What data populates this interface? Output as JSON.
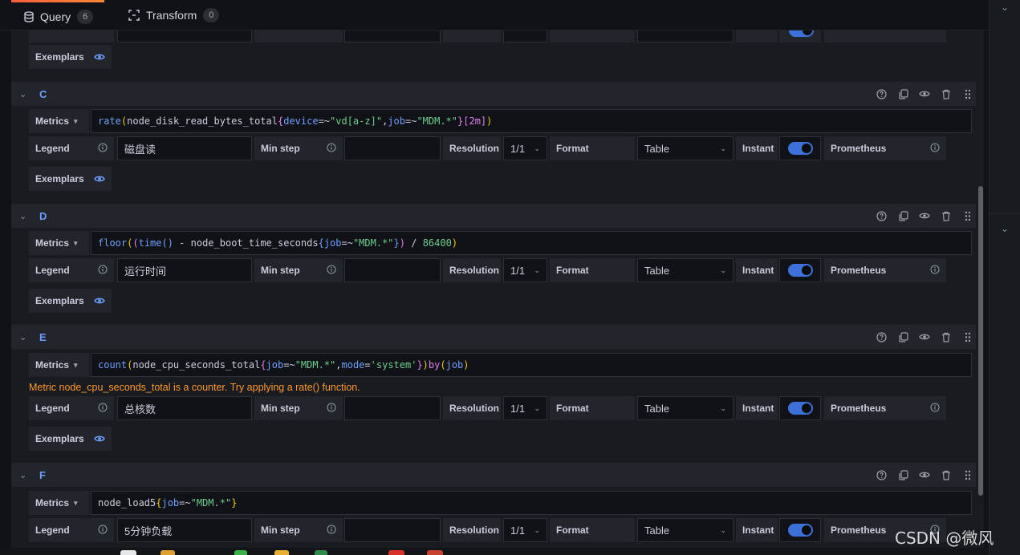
{
  "tabs": [
    {
      "label": "Query",
      "count": "6"
    },
    {
      "label": "Transform",
      "count": "0"
    }
  ],
  "labels": {
    "exemplars": "Exemplars",
    "metrics": "Metrics",
    "legend": "Legend",
    "min_step": "Min step",
    "resolution": "Resolution",
    "format": "Format",
    "instant": "Instant",
    "datasource": "Prometheus"
  },
  "queries": [
    {
      "letter": "C",
      "legend": "磁盘读",
      "resolution": "1/1",
      "format": "Table"
    },
    {
      "letter": "D",
      "legend": "运行时间",
      "resolution": "1/1",
      "format": "Table"
    },
    {
      "letter": "E",
      "legend": "总核数",
      "resolution": "1/1",
      "format": "Table",
      "warning": "Metric node_cpu_seconds_total is a counter. Try applying a rate() function."
    },
    {
      "letter": "F",
      "legend": "5分钟负载",
      "resolution": "1/1",
      "format": "Table"
    }
  ],
  "partial_top": {
    "legend": "..."
  },
  "watermark": "CSDN @微风",
  "colors": {
    "accent": "#6e9fff",
    "warning": "#ff9830",
    "toggle": "#3d71d9",
    "string": "#6ccf8e",
    "paren": "#f2cc0c",
    "brace_pink": "#e07cf0"
  }
}
